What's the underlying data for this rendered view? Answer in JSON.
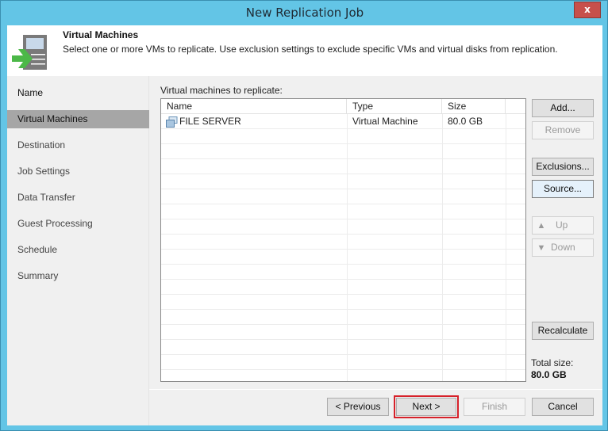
{
  "window": {
    "title": "New Replication Job",
    "close_label": "x"
  },
  "header": {
    "title": "Virtual Machines",
    "description": "Select one or more VMs to replicate. Use exclusion settings to exclude specific VMs and virtual disks from replication.",
    "icon": "vm-replication-icon"
  },
  "sidebar": {
    "items": [
      {
        "label": "Name",
        "state": "done"
      },
      {
        "label": "Virtual Machines",
        "state": "active"
      },
      {
        "label": "Destination",
        "state": "pending"
      },
      {
        "label": "Job Settings",
        "state": "pending"
      },
      {
        "label": "Data Transfer",
        "state": "pending"
      },
      {
        "label": "Guest Processing",
        "state": "pending"
      },
      {
        "label": "Schedule",
        "state": "pending"
      },
      {
        "label": "Summary",
        "state": "pending"
      }
    ]
  },
  "main": {
    "list_label": "Virtual machines to replicate:",
    "columns": [
      "Name",
      "Type",
      "Size"
    ],
    "rows": [
      {
        "name": "FILE SERVER",
        "type": "Virtual Machine",
        "size": "80.0 GB",
        "icon": "vm-icon"
      }
    ],
    "side_buttons": {
      "add": "Add...",
      "remove": "Remove",
      "exclusions": "Exclusions...",
      "source": "Source...",
      "up": "Up",
      "down": "Down",
      "recalculate": "Recalculate"
    },
    "total_size_label": "Total size:",
    "total_size_value": "80.0 GB"
  },
  "footer": {
    "previous": "< Previous",
    "next": "Next >",
    "finish": "Finish",
    "cancel": "Cancel"
  },
  "colors": {
    "title_bar": "#63c5e6",
    "close_button": "#c7504b",
    "active_nav": "#a6a6a6",
    "next_highlight": "#d6212a",
    "arrow_green": "#4cb848"
  }
}
